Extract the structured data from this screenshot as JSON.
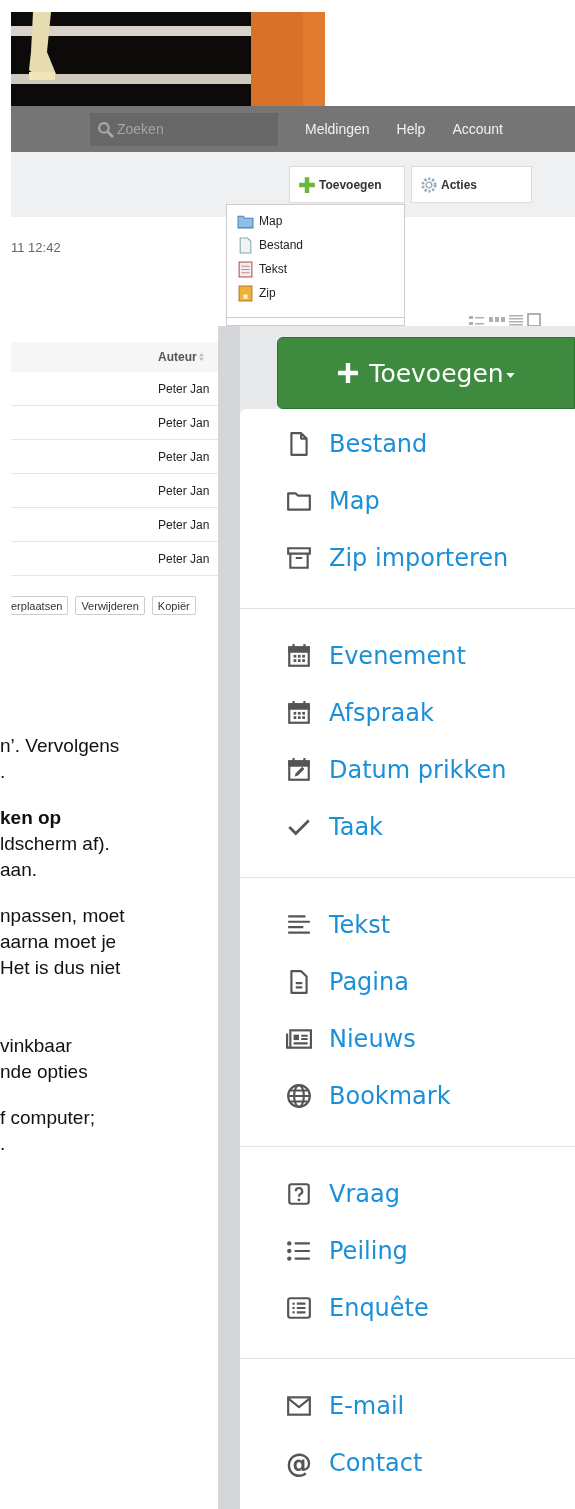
{
  "old_app": {
    "nav": {
      "search": {
        "placeholder": "Zoeken"
      },
      "links": [
        "Meldingen",
        "Help",
        "Account"
      ]
    },
    "toolbar": [
      {
        "label": "Toevoegen",
        "kind": "add"
      },
      {
        "label": "Acties",
        "kind": "actions"
      }
    ],
    "dropdown": [
      {
        "label": "Map",
        "kind": "folder"
      },
      {
        "label": "Bestand",
        "kind": "file"
      },
      {
        "label": "Tekst",
        "kind": "text"
      },
      {
        "label": "Zip",
        "kind": "zip"
      }
    ],
    "timestamp": "11 12:42",
    "table": {
      "columns": [
        "Auteur"
      ],
      "rows": [
        [
          "Peter Jan"
        ],
        [
          "Peter Jan"
        ],
        [
          "Peter Jan"
        ],
        [
          "Peter Jan"
        ],
        [
          "Peter Jan"
        ],
        [
          "Peter Jan"
        ]
      ]
    },
    "actions": [
      "erplaatsen",
      "Verwijderen",
      "Kopiër"
    ]
  },
  "document": {
    "paragraphs": [
      {
        "lines": [
          {
            "text": "n’. Vervolgens"
          },
          {
            "text": "."
          }
        ]
      },
      {
        "lines": [
          {
            "text": "ken op",
            "bold": true
          },
          {
            "text": "ldscherm af)."
          },
          {
            "text": "aan."
          }
        ]
      },
      {
        "lines": [
          {
            "text": "npassen, moet"
          },
          {
            "text": "aarna moet je"
          },
          {
            "text": "Het is dus niet"
          }
        ]
      },
      {
        "lines": [
          {
            "text": "vinkbaar"
          },
          {
            "text": "nde opties"
          }
        ]
      },
      {
        "lines": [
          {
            "text": "f computer;"
          },
          {
            "text": "."
          }
        ]
      }
    ]
  },
  "new_app": {
    "add_button": {
      "label": "Toevoegen"
    },
    "menu": [
      [
        {
          "label": "Bestand",
          "kind": "file"
        },
        {
          "label": "Map",
          "kind": "folder"
        },
        {
          "label": "Zip importeren",
          "kind": "archive"
        }
      ],
      [
        {
          "label": "Evenement",
          "kind": "calendar"
        },
        {
          "label": "Afspraak",
          "kind": "calendar"
        },
        {
          "label": "Datum prikken",
          "kind": "calendar-edit"
        },
        {
          "label": "Taak",
          "kind": "check"
        }
      ],
      [
        {
          "label": "Tekst",
          "kind": "lines"
        },
        {
          "label": "Pagina",
          "kind": "page"
        },
        {
          "label": "Nieuws",
          "kind": "news"
        },
        {
          "label": "Bookmark",
          "kind": "globe"
        }
      ],
      [
        {
          "label": "Vraag",
          "kind": "question"
        },
        {
          "label": "Peiling",
          "kind": "list"
        },
        {
          "label": "Enquête",
          "kind": "survey"
        }
      ],
      [
        {
          "label": "E-mail",
          "kind": "mail"
        },
        {
          "label": "Contact",
          "kind": "glyph",
          "glyph": "@"
        }
      ]
    ]
  }
}
